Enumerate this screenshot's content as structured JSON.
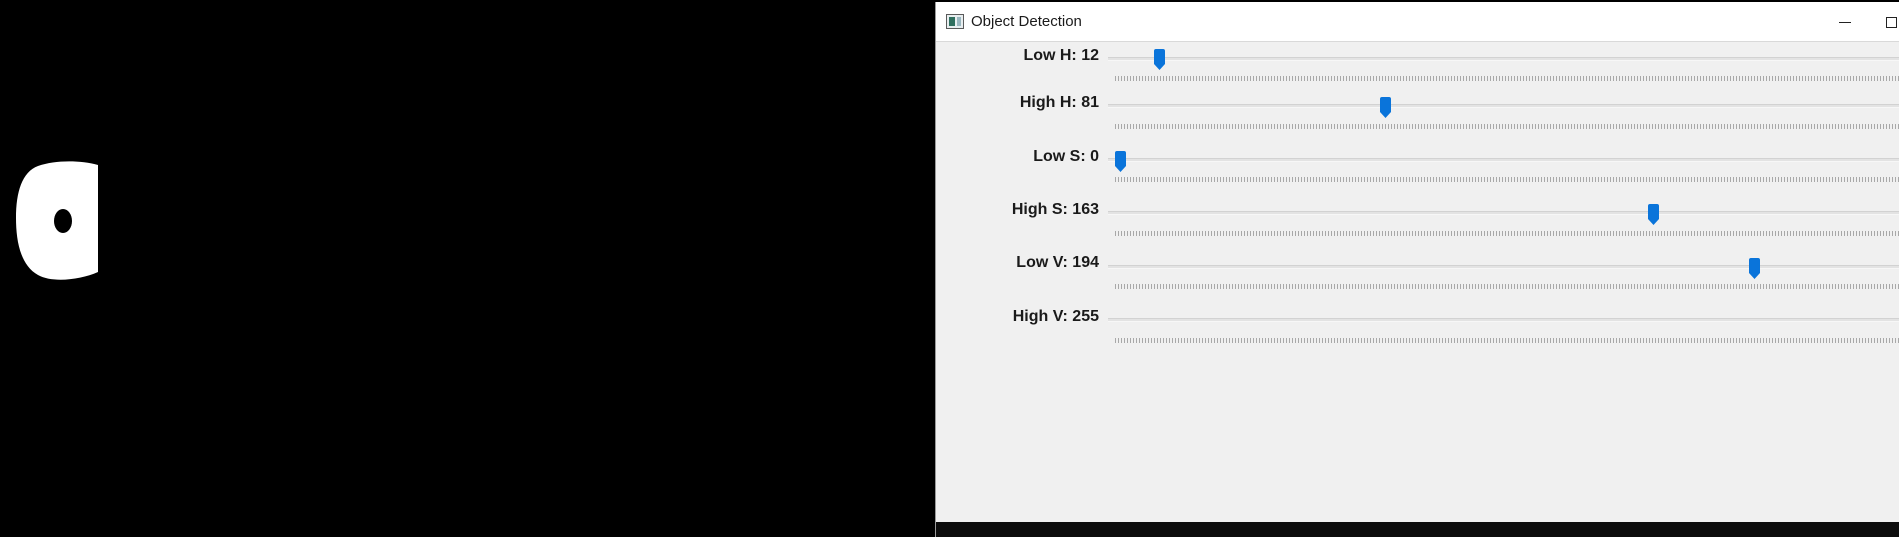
{
  "window": {
    "title": "Object Detection",
    "accent_color": "#0a74da"
  },
  "mask_view": {
    "description_icon": "binary-mask-image"
  },
  "trackbars": [
    {
      "label": "Low H: 12",
      "value": 12,
      "max": 255
    },
    {
      "label": "High H: 81",
      "value": 81,
      "max": 255
    },
    {
      "label": "Low S: 0",
      "value": 0,
      "max": 255
    },
    {
      "label": "High S: 163",
      "value": 163,
      "max": 255
    },
    {
      "label": "Low V: 194",
      "value": 194,
      "max": 255
    },
    {
      "label": "High V: 255",
      "value": 255,
      "max": 255
    }
  ]
}
